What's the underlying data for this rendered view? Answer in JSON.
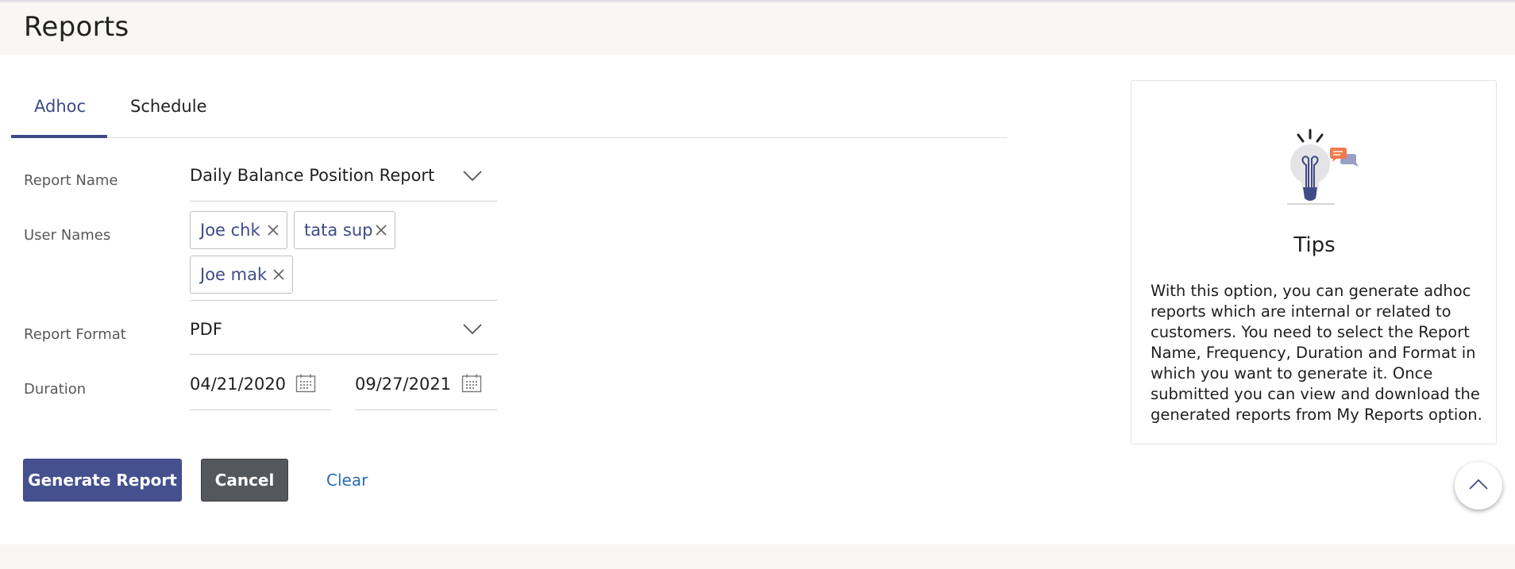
{
  "page": {
    "title": "Reports"
  },
  "tabs": [
    {
      "label": "Adhoc",
      "active": true
    },
    {
      "label": "Schedule",
      "active": false
    }
  ],
  "form": {
    "report_name": {
      "label": "Report Name",
      "value": "Daily Balance Position Report"
    },
    "user_names": {
      "label": "User Names",
      "chips": [
        "Joe chk",
        "tata sup",
        "Joe mak"
      ]
    },
    "report_format": {
      "label": "Report Format",
      "value": "PDF"
    },
    "duration": {
      "label": "Duration",
      "from": "04/21/2020",
      "to": "09/27/2021"
    }
  },
  "actions": {
    "generate_label": "Generate Report",
    "cancel_label": "Cancel",
    "clear_label": "Clear"
  },
  "tips": {
    "title": "Tips",
    "text": "With this option, you can generate adhoc reports which are internal or related to customers. You need to select the Report Name, Frequency, Duration and Format in which you want to generate it. Once submitted you can view and download the generated reports from My Reports option."
  },
  "colors": {
    "accent": "#3f4b87",
    "primary_button": "#45508f",
    "secondary_button": "#54575c",
    "link": "#2b6bb3",
    "page_bg": "#f8f7f5"
  },
  "icons": [
    "chevron-down-icon",
    "remove-chip-icon",
    "calendar-icon",
    "lightbulb-icon",
    "chat-bubble-icon",
    "chevron-up-icon"
  ]
}
